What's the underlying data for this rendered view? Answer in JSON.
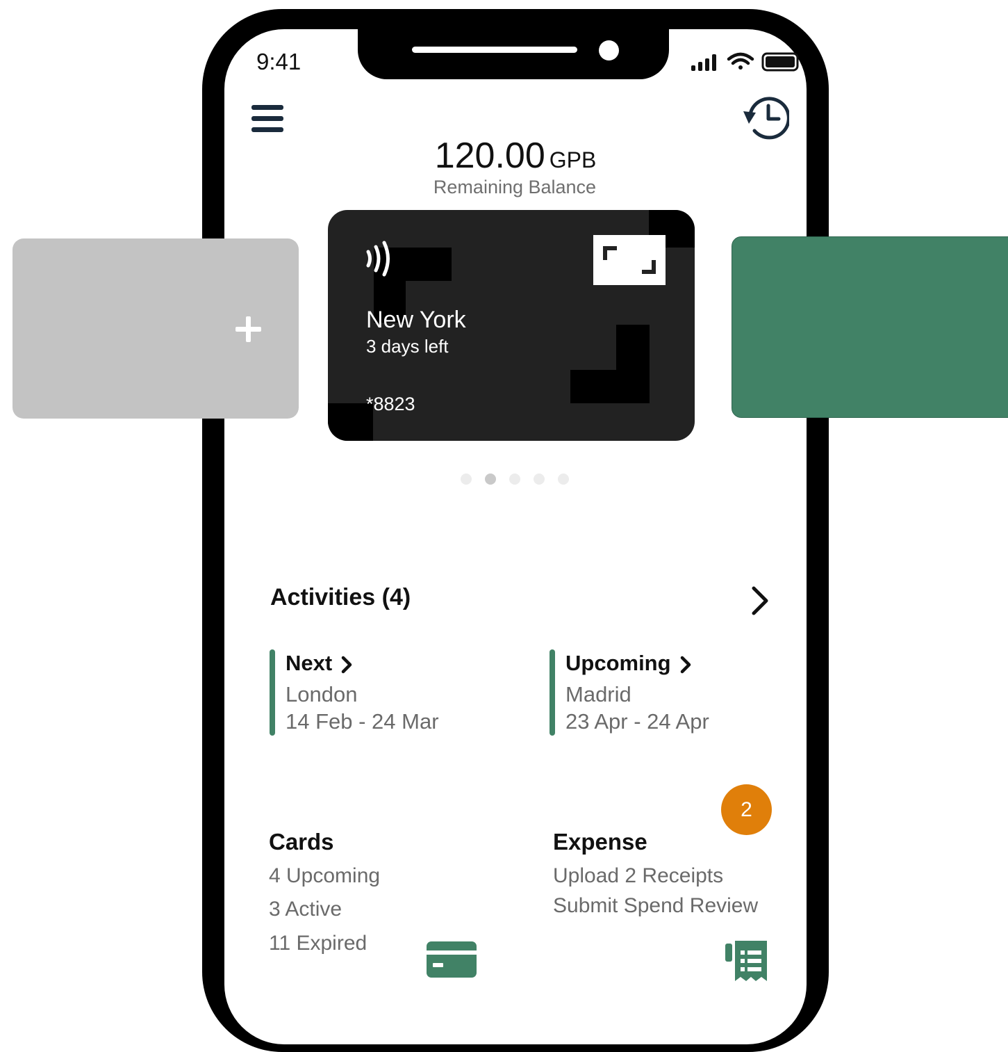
{
  "status_bar": {
    "time": "9:41",
    "icons": [
      "signal-icon",
      "wifi-icon",
      "battery-icon"
    ]
  },
  "header": {
    "menu_icon": "menu-icon",
    "history_icon": "history-icon"
  },
  "balance": {
    "amount": "120.00",
    "currency": "GPB",
    "label": "Remaining Balance"
  },
  "carousel": {
    "add_card_icon": "plus-icon",
    "current_card": {
      "city": "New York",
      "days_left": "3 days left",
      "number": "*8823",
      "contactless_icon": "contactless-icon",
      "chip_icon": "card-chip-icon"
    },
    "page_count": 5,
    "active_page": 2
  },
  "activities": {
    "title": "Activities (4)",
    "next": {
      "label": "Next",
      "city": "London",
      "dates": "14 Feb - 24 Mar"
    },
    "upcoming": {
      "label": "Upcoming",
      "city": "Madrid",
      "dates": "23 Apr - 24 Apr"
    }
  },
  "cards_section": {
    "title": "Cards",
    "upcoming": "4 Upcoming",
    "active": "3 Active",
    "expired": "11 Expired",
    "icon": "credit-card-icon"
  },
  "expense_section": {
    "title": "Expense",
    "line1": "Upload 2 Receipts",
    "line2": "Submit Spend Review",
    "badge": "2",
    "icon": "receipt-icon"
  },
  "colors": {
    "accent_green": "#418266",
    "badge_orange": "#e07f0a",
    "card_dark": "#222222",
    "card_placeholder": "#c3c3c3"
  }
}
